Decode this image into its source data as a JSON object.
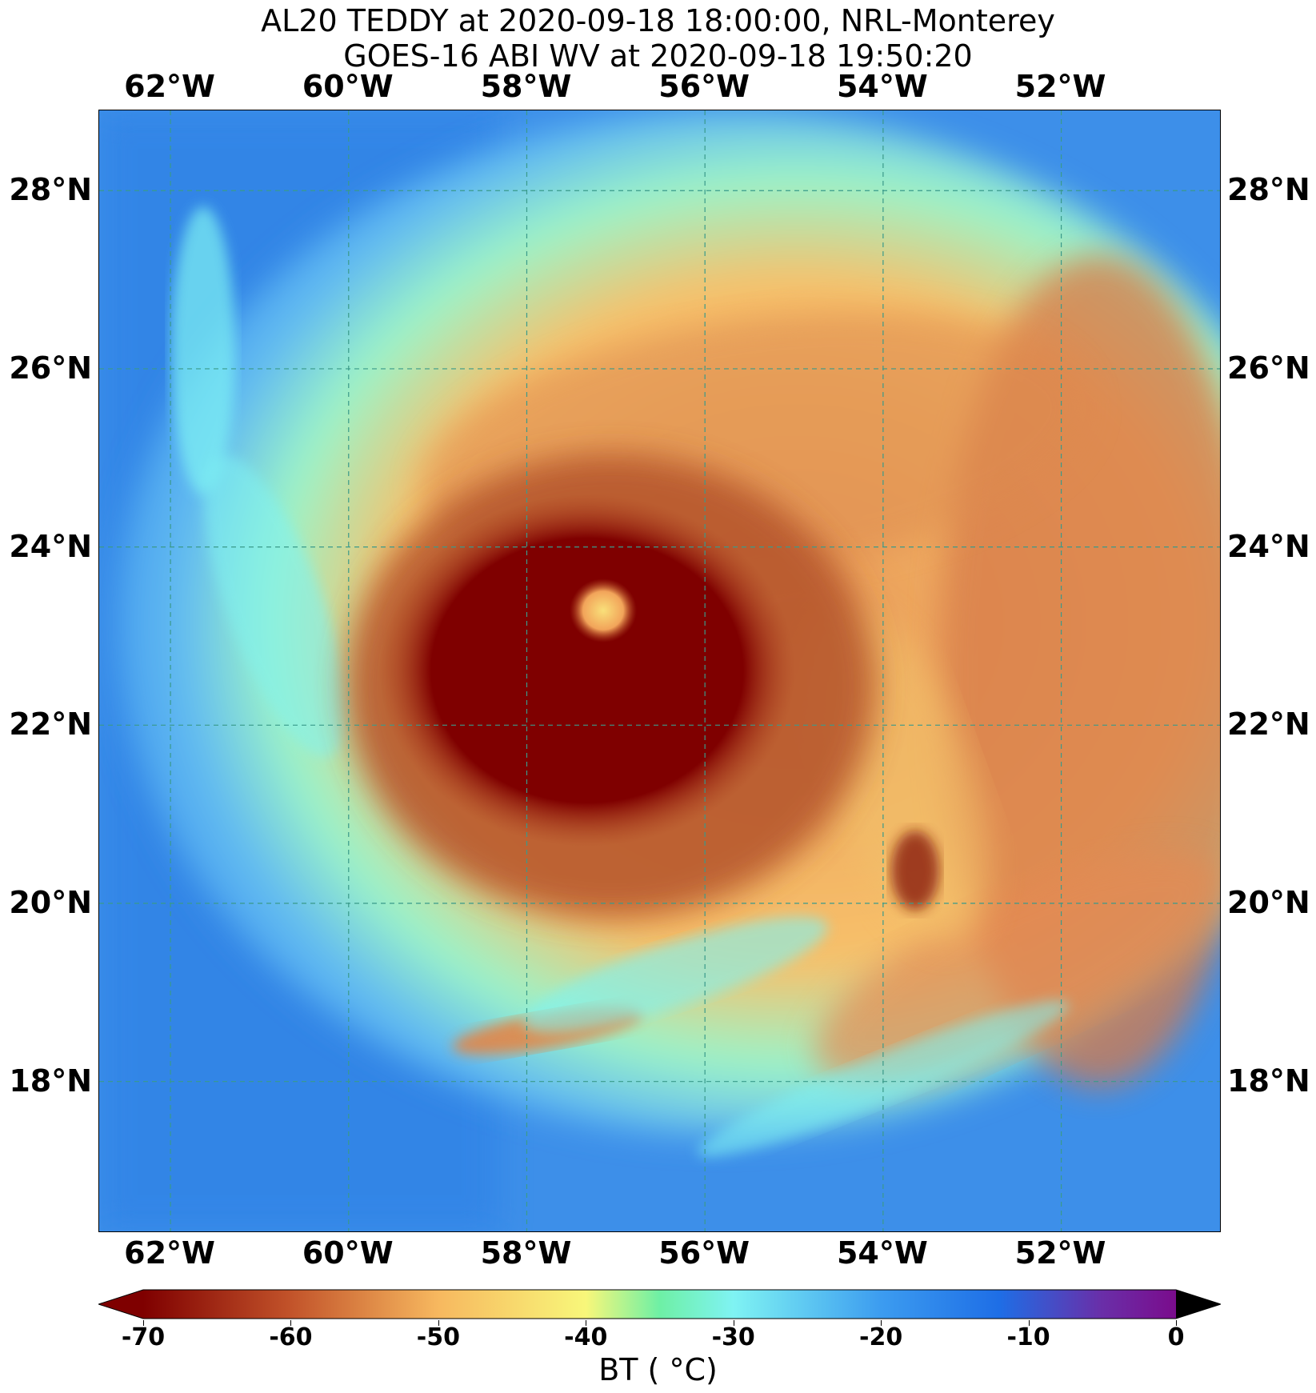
{
  "title": {
    "line1": "AL20 TEDDY at 2020-09-18 18:00:00, NRL-Monterey",
    "line2": "GOES-16 ABI WV at 2020-09-18 19:50:20"
  },
  "map": {
    "extent": {
      "lon_west": -62.8,
      "lon_east": -50.2,
      "lat_south": 16.3,
      "lat_north": 28.9
    },
    "lon_ticks": [
      {
        "value": -62,
        "label": "62°W"
      },
      {
        "value": -60,
        "label": "60°W"
      },
      {
        "value": -58,
        "label": "58°W"
      },
      {
        "value": -56,
        "label": "56°W"
      },
      {
        "value": -54,
        "label": "54°W"
      },
      {
        "value": -52,
        "label": "52°W"
      }
    ],
    "lat_ticks": [
      {
        "value": 28,
        "label": "28°N"
      },
      {
        "value": 26,
        "label": "26°N"
      },
      {
        "value": 24,
        "label": "24°N"
      },
      {
        "value": 22,
        "label": "22°N"
      },
      {
        "value": 20,
        "label": "20°N"
      },
      {
        "value": 18,
        "label": "18°N"
      }
    ],
    "gridlines": true,
    "gridline_color": "#3a9a8a",
    "storm_center": {
      "lon": -56.6,
      "lat": 22.8
    }
  },
  "colorbar": {
    "label": "BT ( °C)",
    "min": -70,
    "max": 0,
    "extend": "both",
    "ticks": [
      {
        "value": -70,
        "label": "-70"
      },
      {
        "value": -60,
        "label": "-60"
      },
      {
        "value": -50,
        "label": "-50"
      },
      {
        "value": -40,
        "label": "-40"
      },
      {
        "value": -30,
        "label": "-30"
      },
      {
        "value": -20,
        "label": "-20"
      },
      {
        "value": -10,
        "label": "-10"
      },
      {
        "value": 0,
        "label": "0"
      }
    ],
    "stops": [
      {
        "value": -70,
        "color": "#7f0000"
      },
      {
        "value": -60,
        "color": "#c2532a"
      },
      {
        "value": -50,
        "color": "#f7b85f"
      },
      {
        "value": -40,
        "color": "#f8f77a"
      },
      {
        "value": -35,
        "color": "#6ef0a5"
      },
      {
        "value": -30,
        "color": "#7ff3f3"
      },
      {
        "value": -20,
        "color": "#3c9cf0"
      },
      {
        "value": -12,
        "color": "#1e6ee6"
      },
      {
        "value": -5,
        "color": "#6a2ea8"
      },
      {
        "value": 0,
        "color": "#7a0c8c"
      }
    ],
    "under_color": "#7f0000",
    "over_color": "#000000"
  }
}
